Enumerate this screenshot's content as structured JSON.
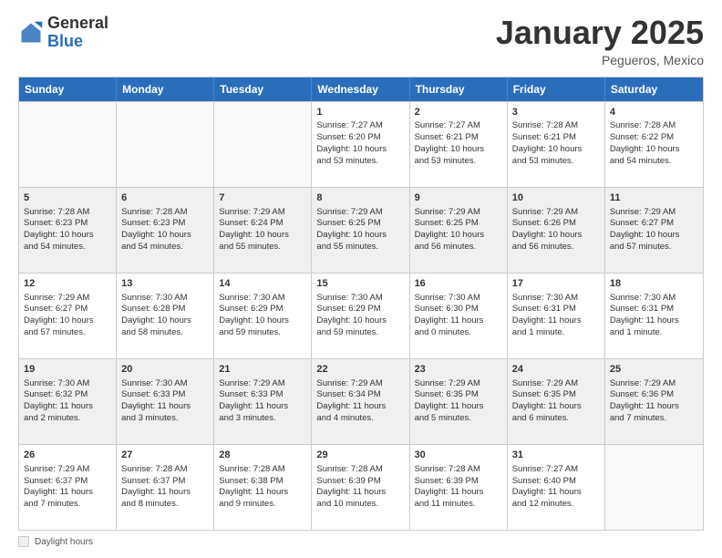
{
  "header": {
    "logo": {
      "general": "General",
      "blue": "Blue"
    },
    "title": "January 2025",
    "location": "Pegueros, Mexico"
  },
  "calendar": {
    "days": [
      "Sunday",
      "Monday",
      "Tuesday",
      "Wednesday",
      "Thursday",
      "Friday",
      "Saturday"
    ],
    "rows": [
      [
        {
          "num": "",
          "lines": [],
          "empty": true
        },
        {
          "num": "",
          "lines": [],
          "empty": true
        },
        {
          "num": "",
          "lines": [],
          "empty": true
        },
        {
          "num": "1",
          "lines": [
            "Sunrise: 7:27 AM",
            "Sunset: 6:20 PM",
            "Daylight: 10 hours",
            "and 53 minutes."
          ]
        },
        {
          "num": "2",
          "lines": [
            "Sunrise: 7:27 AM",
            "Sunset: 6:21 PM",
            "Daylight: 10 hours",
            "and 53 minutes."
          ]
        },
        {
          "num": "3",
          "lines": [
            "Sunrise: 7:28 AM",
            "Sunset: 6:21 PM",
            "Daylight: 10 hours",
            "and 53 minutes."
          ]
        },
        {
          "num": "4",
          "lines": [
            "Sunrise: 7:28 AM",
            "Sunset: 6:22 PM",
            "Daylight: 10 hours",
            "and 54 minutes."
          ]
        }
      ],
      [
        {
          "num": "5",
          "lines": [
            "Sunrise: 7:28 AM",
            "Sunset: 6:23 PM",
            "Daylight: 10 hours",
            "and 54 minutes."
          ],
          "shaded": true
        },
        {
          "num": "6",
          "lines": [
            "Sunrise: 7:28 AM",
            "Sunset: 6:23 PM",
            "Daylight: 10 hours",
            "and 54 minutes."
          ],
          "shaded": true
        },
        {
          "num": "7",
          "lines": [
            "Sunrise: 7:29 AM",
            "Sunset: 6:24 PM",
            "Daylight: 10 hours",
            "and 55 minutes."
          ],
          "shaded": true
        },
        {
          "num": "8",
          "lines": [
            "Sunrise: 7:29 AM",
            "Sunset: 6:25 PM",
            "Daylight: 10 hours",
            "and 55 minutes."
          ],
          "shaded": true
        },
        {
          "num": "9",
          "lines": [
            "Sunrise: 7:29 AM",
            "Sunset: 6:25 PM",
            "Daylight: 10 hours",
            "and 56 minutes."
          ],
          "shaded": true
        },
        {
          "num": "10",
          "lines": [
            "Sunrise: 7:29 AM",
            "Sunset: 6:26 PM",
            "Daylight: 10 hours",
            "and 56 minutes."
          ],
          "shaded": true
        },
        {
          "num": "11",
          "lines": [
            "Sunrise: 7:29 AM",
            "Sunset: 6:27 PM",
            "Daylight: 10 hours",
            "and 57 minutes."
          ],
          "shaded": true
        }
      ],
      [
        {
          "num": "12",
          "lines": [
            "Sunrise: 7:29 AM",
            "Sunset: 6:27 PM",
            "Daylight: 10 hours",
            "and 57 minutes."
          ]
        },
        {
          "num": "13",
          "lines": [
            "Sunrise: 7:30 AM",
            "Sunset: 6:28 PM",
            "Daylight: 10 hours",
            "and 58 minutes."
          ]
        },
        {
          "num": "14",
          "lines": [
            "Sunrise: 7:30 AM",
            "Sunset: 6:29 PM",
            "Daylight: 10 hours",
            "and 59 minutes."
          ]
        },
        {
          "num": "15",
          "lines": [
            "Sunrise: 7:30 AM",
            "Sunset: 6:29 PM",
            "Daylight: 10 hours",
            "and 59 minutes."
          ]
        },
        {
          "num": "16",
          "lines": [
            "Sunrise: 7:30 AM",
            "Sunset: 6:30 PM",
            "Daylight: 11 hours",
            "and 0 minutes."
          ]
        },
        {
          "num": "17",
          "lines": [
            "Sunrise: 7:30 AM",
            "Sunset: 6:31 PM",
            "Daylight: 11 hours",
            "and 1 minute."
          ]
        },
        {
          "num": "18",
          "lines": [
            "Sunrise: 7:30 AM",
            "Sunset: 6:31 PM",
            "Daylight: 11 hours",
            "and 1 minute."
          ]
        }
      ],
      [
        {
          "num": "19",
          "lines": [
            "Sunrise: 7:30 AM",
            "Sunset: 6:32 PM",
            "Daylight: 11 hours",
            "and 2 minutes."
          ],
          "shaded": true
        },
        {
          "num": "20",
          "lines": [
            "Sunrise: 7:30 AM",
            "Sunset: 6:33 PM",
            "Daylight: 11 hours",
            "and 3 minutes."
          ],
          "shaded": true
        },
        {
          "num": "21",
          "lines": [
            "Sunrise: 7:29 AM",
            "Sunset: 6:33 PM",
            "Daylight: 11 hours",
            "and 3 minutes."
          ],
          "shaded": true
        },
        {
          "num": "22",
          "lines": [
            "Sunrise: 7:29 AM",
            "Sunset: 6:34 PM",
            "Daylight: 11 hours",
            "and 4 minutes."
          ],
          "shaded": true
        },
        {
          "num": "23",
          "lines": [
            "Sunrise: 7:29 AM",
            "Sunset: 6:35 PM",
            "Daylight: 11 hours",
            "and 5 minutes."
          ],
          "shaded": true
        },
        {
          "num": "24",
          "lines": [
            "Sunrise: 7:29 AM",
            "Sunset: 6:35 PM",
            "Daylight: 11 hours",
            "and 6 minutes."
          ],
          "shaded": true
        },
        {
          "num": "25",
          "lines": [
            "Sunrise: 7:29 AM",
            "Sunset: 6:36 PM",
            "Daylight: 11 hours",
            "and 7 minutes."
          ],
          "shaded": true
        }
      ],
      [
        {
          "num": "26",
          "lines": [
            "Sunrise: 7:29 AM",
            "Sunset: 6:37 PM",
            "Daylight: 11 hours",
            "and 7 minutes."
          ]
        },
        {
          "num": "27",
          "lines": [
            "Sunrise: 7:28 AM",
            "Sunset: 6:37 PM",
            "Daylight: 11 hours",
            "and 8 minutes."
          ]
        },
        {
          "num": "28",
          "lines": [
            "Sunrise: 7:28 AM",
            "Sunset: 6:38 PM",
            "Daylight: 11 hours",
            "and 9 minutes."
          ]
        },
        {
          "num": "29",
          "lines": [
            "Sunrise: 7:28 AM",
            "Sunset: 6:39 PM",
            "Daylight: 11 hours",
            "and 10 minutes."
          ]
        },
        {
          "num": "30",
          "lines": [
            "Sunrise: 7:28 AM",
            "Sunset: 6:39 PM",
            "Daylight: 11 hours",
            "and 11 minutes."
          ]
        },
        {
          "num": "31",
          "lines": [
            "Sunrise: 7:27 AM",
            "Sunset: 6:40 PM",
            "Daylight: 11 hours",
            "and 12 minutes."
          ]
        },
        {
          "num": "",
          "lines": [],
          "empty": true
        }
      ]
    ]
  },
  "footer": {
    "legend_label": "Daylight hours"
  }
}
